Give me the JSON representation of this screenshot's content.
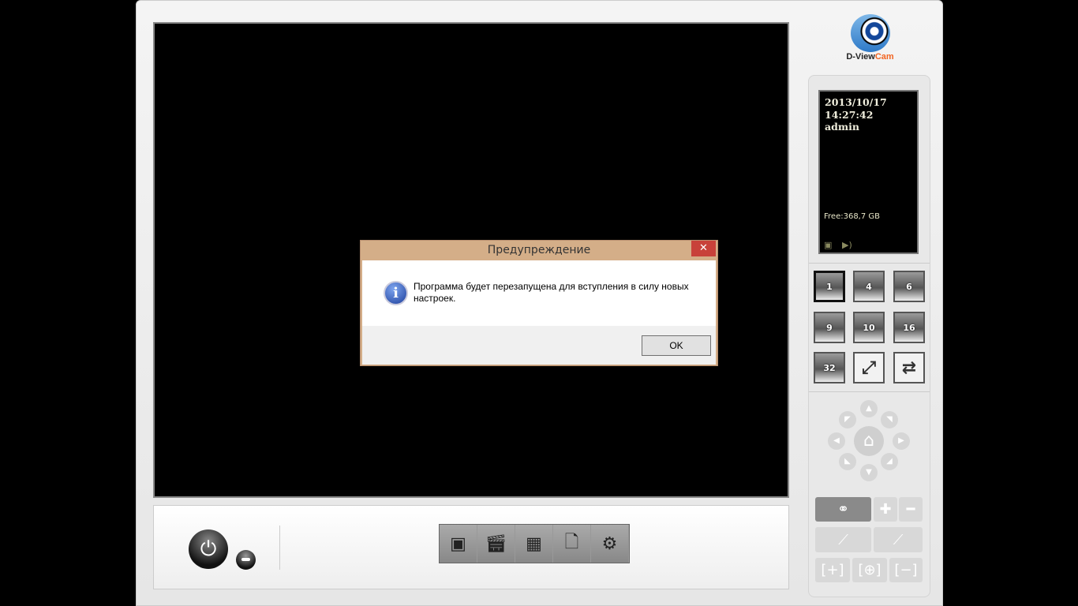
{
  "app": {
    "logo_text": "D-View",
    "logo_text_accent": "Cam"
  },
  "info": {
    "date": "2013/10/17",
    "time": "14:27:42",
    "user": "admin",
    "free": "Free:368,7 GB"
  },
  "layouts": [
    "1",
    "4",
    "6",
    "9",
    "10",
    "16",
    "32"
  ],
  "dialog": {
    "title": "Предупреждение",
    "message": "Программа будет перезапущена для вступления в силу новых настроек.",
    "ok": "OK",
    "close": "✕"
  }
}
